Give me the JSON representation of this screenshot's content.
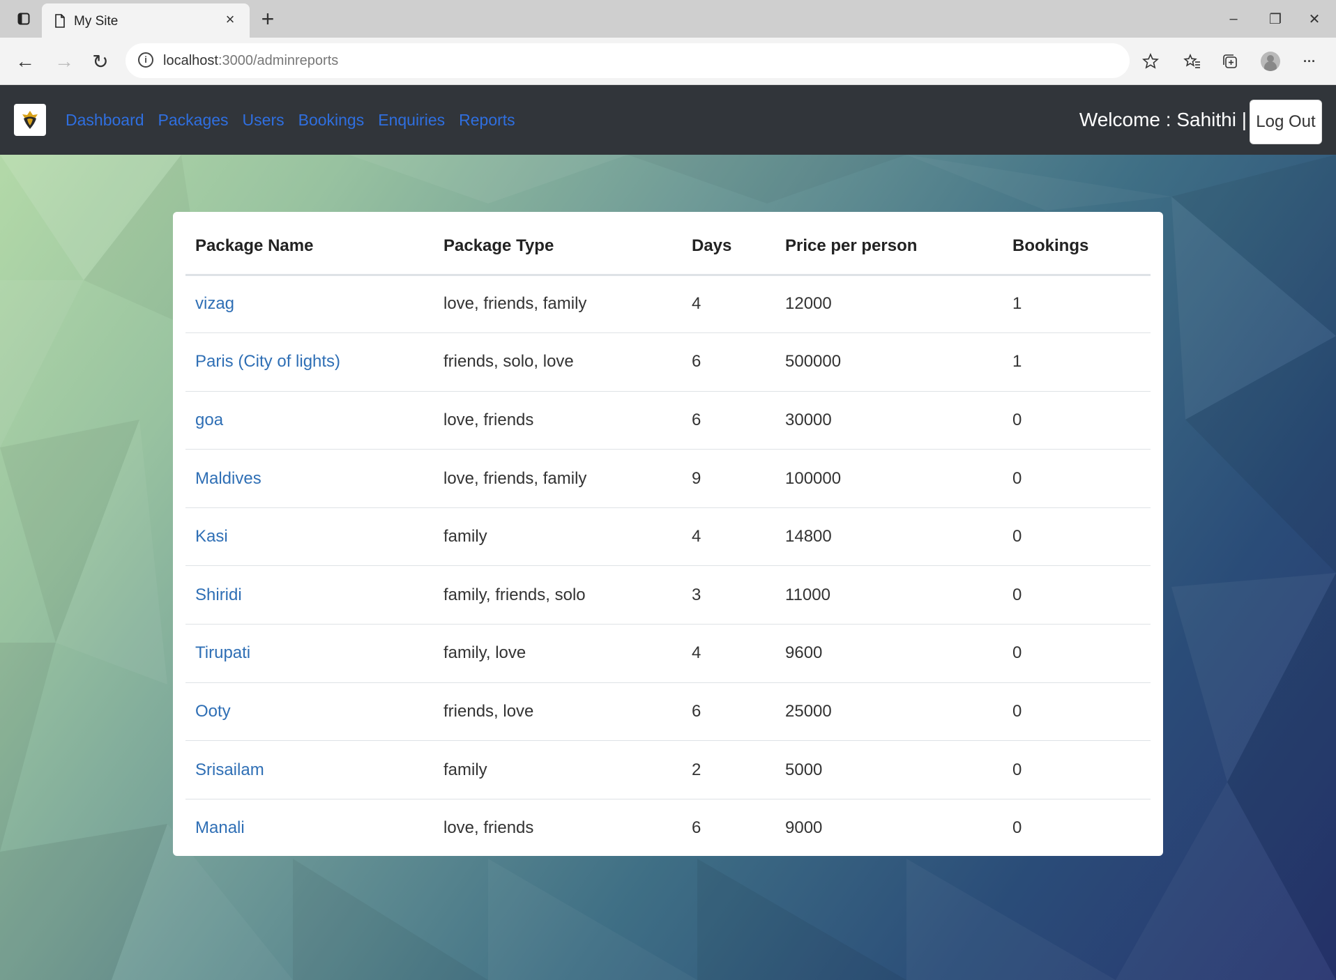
{
  "browser": {
    "tab_title": "My Site",
    "tab_close": "×",
    "new_tab": "+",
    "url_host": "localhost",
    "url_path": ":3000/adminreports",
    "window_controls": {
      "minimize": "–",
      "restore": "❐",
      "close": "✕"
    },
    "toolbar_icons": [
      "favorite-add-icon",
      "favorites-icon",
      "collections-icon",
      "profile-icon",
      "more-icon"
    ],
    "more_label": "···"
  },
  "nav": {
    "links": [
      "Dashboard",
      "Packages",
      "Users",
      "Bookings",
      "Enquiries",
      "Reports"
    ],
    "welcome": "Welcome : Sahithi |",
    "logout_label": "Log Out"
  },
  "table": {
    "headers": [
      "Package Name",
      "Package Type",
      "Days",
      "Price per person",
      "Bookings"
    ],
    "rows": [
      {
        "name": "vizag",
        "type": "love, friends, family",
        "days": "4",
        "price": "12000",
        "bookings": "1"
      },
      {
        "name": "Paris (City of lights)",
        "type": "friends, solo, love",
        "days": "6",
        "price": "500000",
        "bookings": "1"
      },
      {
        "name": "goa",
        "type": "love, friends",
        "days": "6",
        "price": "30000",
        "bookings": "0"
      },
      {
        "name": "Maldives",
        "type": "love, friends, family",
        "days": "9",
        "price": "100000",
        "bookings": "0"
      },
      {
        "name": "Kasi",
        "type": "family",
        "days": "4",
        "price": "14800",
        "bookings": "0"
      },
      {
        "name": "Shiridi",
        "type": "family, friends, solo",
        "days": "3",
        "price": "11000",
        "bookings": "0"
      },
      {
        "name": "Tirupati",
        "type": "family, love",
        "days": "4",
        "price": "9600",
        "bookings": "0"
      },
      {
        "name": "Ooty",
        "type": "friends, love",
        "days": "6",
        "price": "25000",
        "bookings": "0"
      },
      {
        "name": "Srisailam",
        "type": "family",
        "days": "2",
        "price": "5000",
        "bookings": "0"
      },
      {
        "name": "Manali",
        "type": "love, friends",
        "days": "6",
        "price": "9000",
        "bookings": "0"
      }
    ]
  },
  "colors": {
    "navbar": "#31353a",
    "nav_link": "#2f6fe0",
    "package_link": "#2f6fb5"
  }
}
